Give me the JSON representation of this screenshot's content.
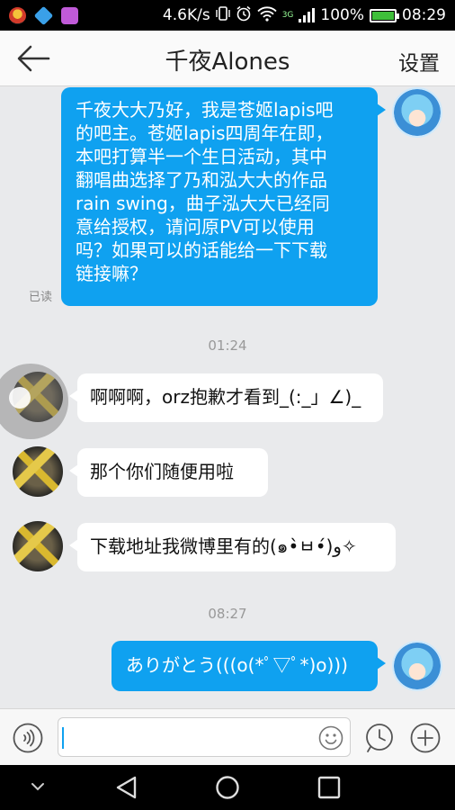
{
  "status_bar": {
    "speed": "4.6K/s",
    "network_type": "3G",
    "battery_percent": "100%",
    "battery_level": 1.0,
    "time": "08:29",
    "icons": [
      "app-icon-a",
      "app-icon-b",
      "app-icon-c",
      "vibrate-icon",
      "alarm-icon",
      "wifi-icon",
      "signal-icon",
      "battery-icon"
    ]
  },
  "header": {
    "title": "千夜Alones",
    "back_icon": "back-arrow-icon",
    "settings_label": "设置"
  },
  "messages": [
    {
      "direction": "out",
      "lines": [
        "千夜大大乃好，我是苍姬lapis吧",
        "的吧主。苍姬lapis四周年在即，",
        "本吧打算半一个生日活动，其中",
        "翻唱曲选择了乃和泓大大的作品",
        "rain swing，曲子泓大大已经同",
        "意给授权，请问原PV可以使用",
        "吗？如果可以的话能给一下下载",
        "链接嘛？"
      ],
      "status": "已读"
    },
    {
      "type": "time",
      "text": "01:24"
    },
    {
      "direction": "in",
      "text": "啊啊啊，orz抱歉才看到_(:_」∠)_"
    },
    {
      "direction": "in",
      "text": "那个你们随便用啦"
    },
    {
      "direction": "in",
      "text": "下载地址我微博里有的(๑•̀ㅂ•́)و✧"
    },
    {
      "type": "time",
      "text": "08:27"
    },
    {
      "direction": "out",
      "text": "ありがとう(((o(*ﾟ▽ﾟ*)o)))"
    }
  ],
  "input_bar": {
    "placeholder": "",
    "value": "",
    "icons": [
      "voice-icon",
      "emoji-icon",
      "clock-icon",
      "plus-icon"
    ]
  },
  "nav_bar": {
    "icons": [
      "hide-keyboard-icon",
      "nav-back-icon",
      "home-icon",
      "recents-icon"
    ]
  },
  "colors": {
    "outgoing_bubble": "#0fa1f0",
    "incoming_bubble": "#ffffff",
    "chat_background": "#e9eaec"
  }
}
